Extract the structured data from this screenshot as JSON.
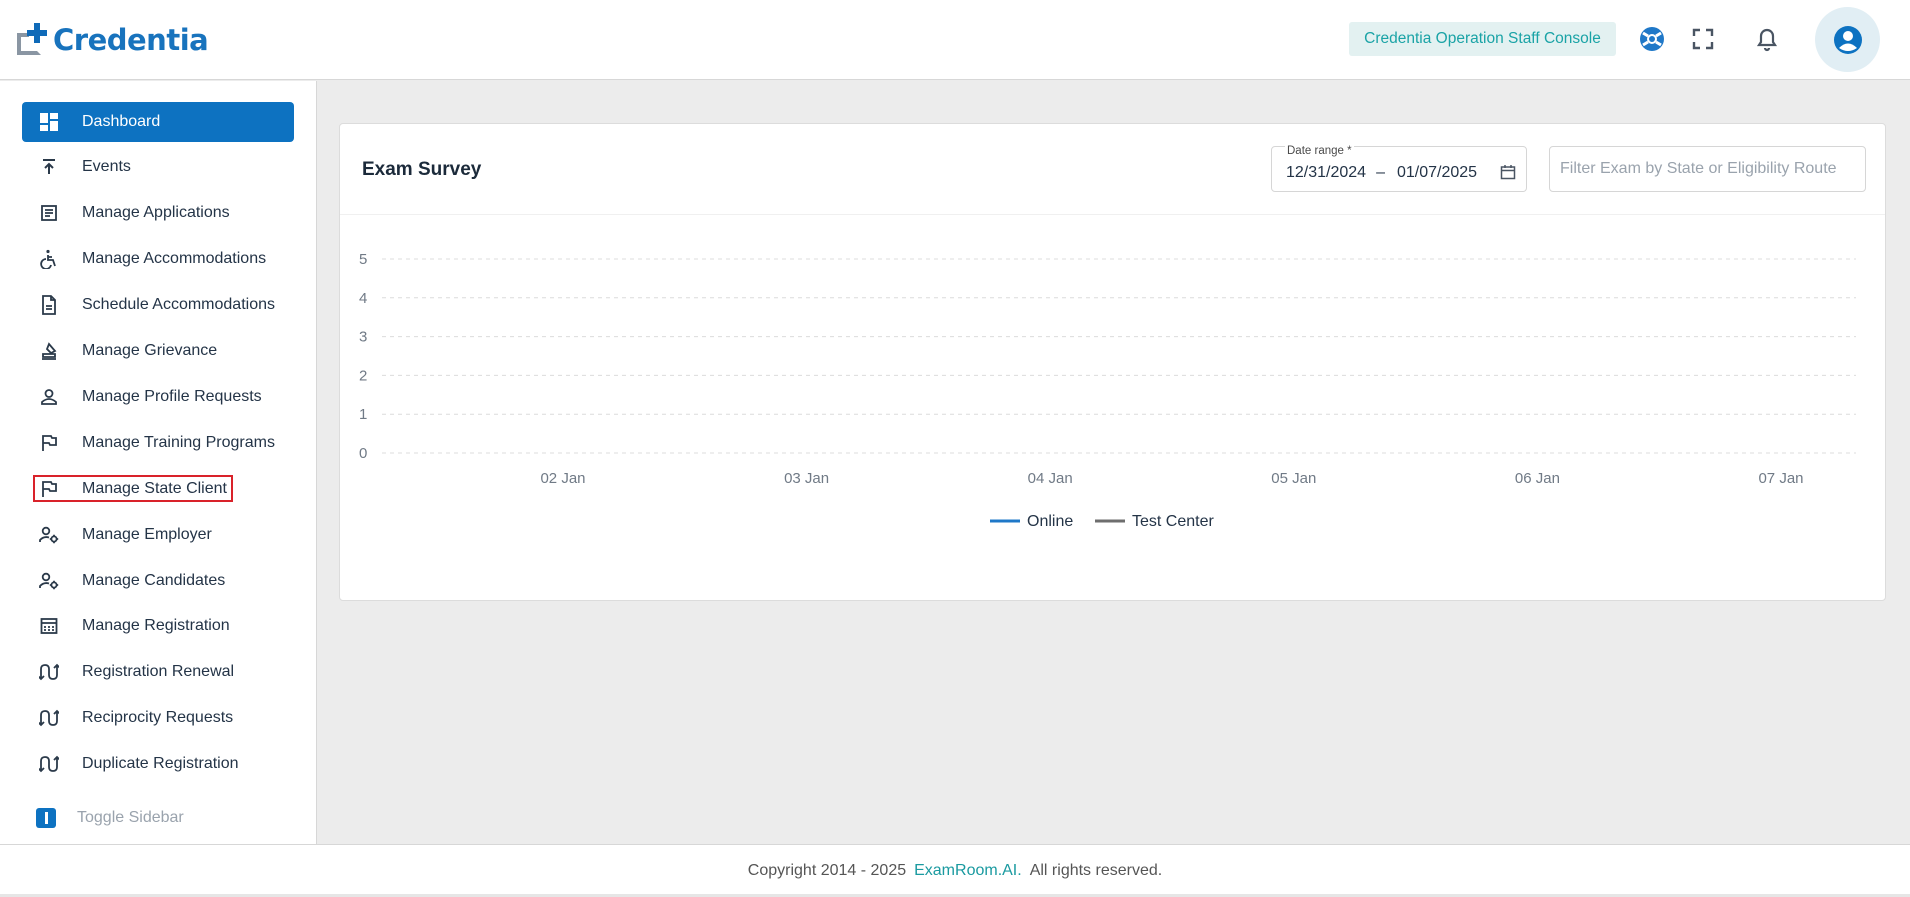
{
  "header": {
    "logo_text": "Credentia",
    "console_label": "Credentia Operation Staff Console",
    "icons": [
      "support-icon",
      "fullscreen-icon",
      "bell-icon",
      "account-icon"
    ]
  },
  "sidebar": {
    "items": [
      {
        "label": "Dashboard",
        "icon": "dashboard-icon",
        "active": true
      },
      {
        "label": "Events",
        "icon": "upload-arrow-icon"
      },
      {
        "label": "Manage Applications",
        "icon": "list-doc-icon"
      },
      {
        "label": "Manage Accommodations",
        "icon": "accessibility-icon"
      },
      {
        "label": "Schedule Accommodations",
        "icon": "document-icon"
      },
      {
        "label": "Manage Grievance",
        "icon": "stamp-icon"
      },
      {
        "label": "Manage Profile Requests",
        "icon": "person-icon"
      },
      {
        "label": "Manage Training Programs",
        "icon": "flag-icon"
      },
      {
        "label": "Manage State Client",
        "icon": "flag-icon",
        "highlighted": true
      },
      {
        "label": "Manage Employer",
        "icon": "person-gear-icon"
      },
      {
        "label": "Manage Candidates",
        "icon": "person-gear-icon"
      },
      {
        "label": "Manage Registration",
        "icon": "registration-icon"
      },
      {
        "label": "Registration Renewal",
        "icon": "swap-icon"
      },
      {
        "label": "Reciprocity Requests",
        "icon": "swap-icon"
      },
      {
        "label": "Duplicate Registration",
        "icon": "swap-icon"
      }
    ],
    "toggle_label": "Toggle Sidebar"
  },
  "card": {
    "title": "Exam Survey",
    "date_range_label": "Date range *",
    "date_start": "12/31/2024",
    "date_separator": "–",
    "date_end": "01/07/2025",
    "filter_placeholder": "Filter Exam by State or Eligibility Route",
    "filter_value": ""
  },
  "chart_data": {
    "type": "line",
    "title": "",
    "x": [
      "02 Jan",
      "03 Jan",
      "04 Jan",
      "05 Jan",
      "06 Jan",
      "07 Jan"
    ],
    "yticks": [
      0,
      1,
      2,
      3,
      4,
      5
    ],
    "ylim": [
      0,
      5
    ],
    "grid": true,
    "legend_position": "bottom",
    "series": [
      {
        "name": "Online",
        "color": "#1f78c8",
        "values": []
      },
      {
        "name": "Test Center",
        "color": "#6e6e6e",
        "values": []
      }
    ]
  },
  "footer": {
    "copyright": "Copyright 2014 - 2025",
    "brand": "ExamRoom.AI.",
    "rights": "All rights reserved."
  }
}
